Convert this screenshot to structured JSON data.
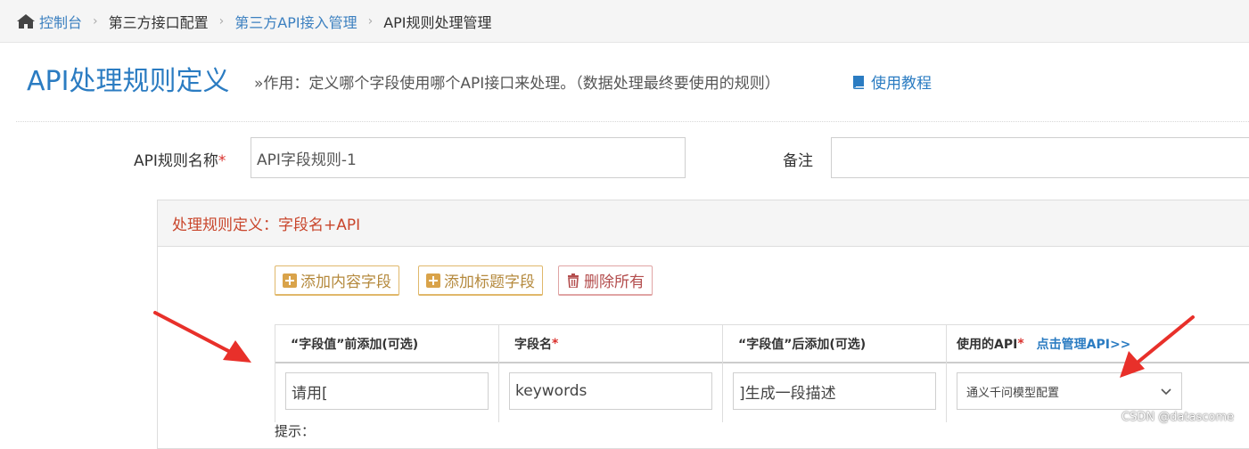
{
  "breadcrumb": {
    "items": [
      {
        "label": "控制台"
      },
      {
        "label": "第三方接口配置"
      },
      {
        "label": "第三方API接入管理"
      },
      {
        "label": "API规则处理管理"
      }
    ]
  },
  "header": {
    "title": "API处理规则定义",
    "subtitle": "»作用：定义哪个字段使用哪个API接口来处理。（数据处理最终要使用的规则）",
    "tutorial_label": "使用教程"
  },
  "form": {
    "rule_name_label": "API规则名称",
    "rule_name_value": "API字段规则-1",
    "note_label": "备注",
    "note_value": ""
  },
  "panel": {
    "title": "处理规则定义：字段名+API",
    "buttons": {
      "add_content": "添加内容字段",
      "add_title": "添加标题字段",
      "delete_all": "删除所有"
    }
  },
  "table": {
    "headers": {
      "prefix": "“字段值”前添加(可选)",
      "field_name": "字段名",
      "suffix": "“字段值”后添加(可选)",
      "api": "使用的API",
      "manage_link": "点击管理API>>"
    },
    "row": {
      "prefix": "请用[",
      "field_name": "keywords",
      "suffix": "]生成一段描述",
      "api": "通义千问模型配置"
    }
  },
  "tip_label": "提示：",
  "watermark": "CSDN @datascome",
  "colors": {
    "link": "#2b7cc2",
    "panel_title": "#c9462c",
    "button_warning": "#b58a3e",
    "button_danger": "#b34d4d",
    "required": "#d9302c",
    "annotation_arrow": "#e8302a"
  }
}
